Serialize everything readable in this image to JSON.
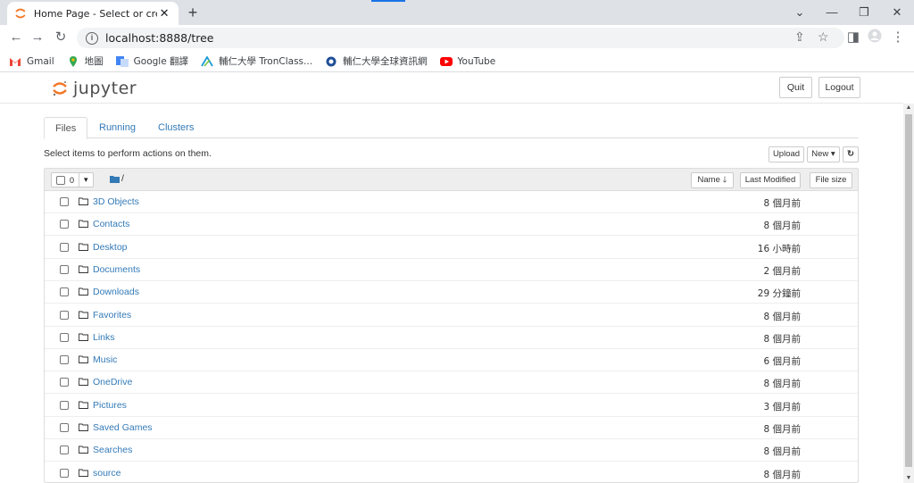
{
  "browser": {
    "tab_title": "Home Page - Select or create a",
    "url": "localhost:8888/tree",
    "bookmarks": [
      {
        "label": "Gmail",
        "icon": "gmail-icon"
      },
      {
        "label": "地圖",
        "icon": "maps-icon"
      },
      {
        "label": "Google 翻譯",
        "icon": "translate-icon"
      },
      {
        "label": "輔仁大學 TronClass...",
        "icon": "tronclass-icon"
      },
      {
        "label": "輔仁大學全球資訊網",
        "icon": "fju-icon"
      },
      {
        "label": "YouTube",
        "icon": "youtube-icon"
      }
    ]
  },
  "jupyter": {
    "logo_text": "jupyter",
    "quit_label": "Quit",
    "logout_label": "Logout",
    "tabs": [
      "Files",
      "Running",
      "Clusters"
    ],
    "help_text": "Select items to perform actions on them.",
    "upload_label": "Upload",
    "new_label": "New ▾",
    "selected_count": "0",
    "path": "/",
    "columns": {
      "name": "Name",
      "last_modified": "Last Modified",
      "file_size": "File size"
    },
    "files": [
      {
        "name": "3D Objects",
        "modified": "8 個月前"
      },
      {
        "name": "Contacts",
        "modified": "8 個月前"
      },
      {
        "name": "Desktop",
        "modified": "16 小時前"
      },
      {
        "name": "Documents",
        "modified": "2 個月前"
      },
      {
        "name": "Downloads",
        "modified": "29 分鐘前"
      },
      {
        "name": "Favorites",
        "modified": "8 個月前"
      },
      {
        "name": "Links",
        "modified": "8 個月前"
      },
      {
        "name": "Music",
        "modified": "6 個月前"
      },
      {
        "name": "OneDrive",
        "modified": "8 個月前"
      },
      {
        "name": "Pictures",
        "modified": "3 個月前"
      },
      {
        "name": "Saved Games",
        "modified": "8 個月前"
      },
      {
        "name": "Searches",
        "modified": "8 個月前"
      },
      {
        "name": "source",
        "modified": "8 個月前"
      }
    ]
  },
  "colors": {
    "link": "#337ab7",
    "jupyter_orange": "#f37726",
    "chrome_frame": "#dee1e6"
  }
}
